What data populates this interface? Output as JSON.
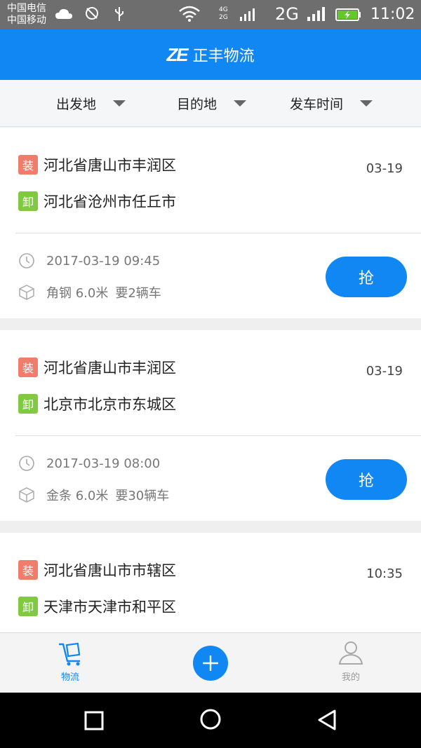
{
  "status_bar": {
    "carrier1": "中国电信",
    "carrier2": "中国移动",
    "net_small_top": "4G",
    "net_small_bottom": "2G",
    "network": "2G",
    "time": "11:02",
    "icons": [
      "cloud-icon",
      "settings-circle-icon",
      "usb-icon",
      "wifi-icon",
      "signal-icon",
      "battery-charging-icon"
    ]
  },
  "header": {
    "logo_text": "ZE",
    "title": "正丰物流"
  },
  "filters": [
    {
      "label": "出发地"
    },
    {
      "label": "目的地"
    },
    {
      "label": "发车时间"
    }
  ],
  "orders": [
    {
      "load_tag": "装",
      "from": "河北省唐山市丰润区",
      "unload_tag": "卸",
      "to": "河北省沧州市任丘市",
      "date": "03-19",
      "datetime": "2017-03-19 09:45",
      "cargo": "角钢 6.0米",
      "trucks": "要2辆车",
      "action": "抢"
    },
    {
      "load_tag": "装",
      "from": "河北省唐山市丰润区",
      "unload_tag": "卸",
      "to": "北京市北京市东城区",
      "date": "03-19",
      "datetime": "2017-03-19 08:00",
      "cargo": "金条 6.0米",
      "trucks": "要30辆车",
      "action": "抢"
    },
    {
      "load_tag": "装",
      "from": "河北省唐山市市辖区",
      "unload_tag": "卸",
      "to": "天津市天津市和平区",
      "date": "10:35"
    }
  ],
  "tabbar": {
    "tab_logistics": "物流",
    "tab_mine": "我的"
  },
  "colors": {
    "primary": "#1187f4",
    "load_tag": "#f07c6c",
    "unload_tag": "#80c940"
  }
}
